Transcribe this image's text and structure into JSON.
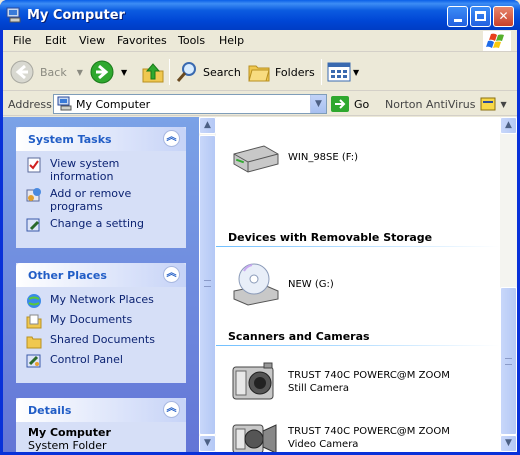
{
  "window": {
    "title": "My Computer"
  },
  "menu": {
    "items": [
      "File",
      "Edit",
      "View",
      "Favorites",
      "Tools",
      "Help"
    ]
  },
  "toolbar": {
    "back": "Back",
    "search": "Search",
    "folders": "Folders"
  },
  "address": {
    "label": "Address",
    "value": "My Computer",
    "go": "Go",
    "norton": "Norton AntiVirus"
  },
  "system_tasks": {
    "title": "System Tasks",
    "items": [
      "View system information",
      "Add or remove programs",
      "Change a setting"
    ]
  },
  "other_places": {
    "title": "Other Places",
    "items": [
      "My Network Places",
      "My Documents",
      "Shared Documents",
      "Control Panel"
    ]
  },
  "details": {
    "title": "Details",
    "name": "My Computer",
    "sub": "System Folder"
  },
  "content": {
    "drive": "WIN_98SE (F:)",
    "removable_header": "Devices with Removable Storage",
    "cd": "NEW (G:)",
    "scanners_header": "Scanners and Cameras",
    "cam1_line1": "TRUST 740C POWERC@M ZOOM",
    "cam1_line2": "Still Camera",
    "cam2_line1": "TRUST 740C POWERC@M ZOOM",
    "cam2_line2": "Video Camera"
  },
  "colors": {
    "titlebar": "#0046d5",
    "task_pane": "#6f8ee0",
    "link": "#0c2372"
  }
}
